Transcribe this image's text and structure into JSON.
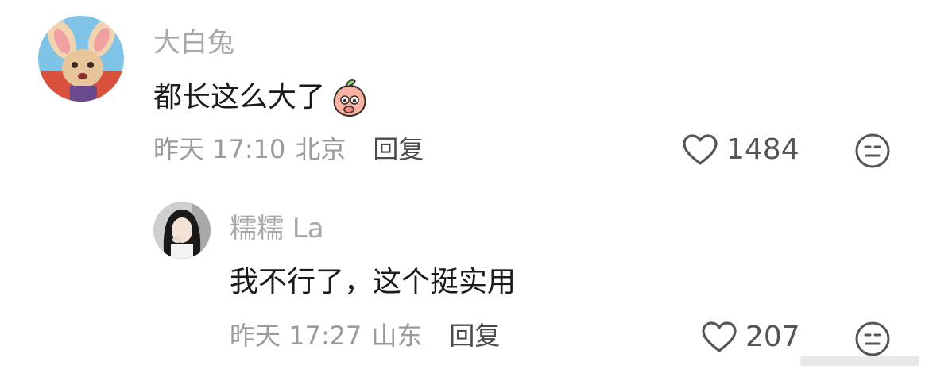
{
  "comments": [
    {
      "username": "大白兔",
      "text": "都长这么大了",
      "emoji_icon": "peach-face-emoji",
      "time": "昨天 17:10",
      "location": "北京",
      "reply_label": "回复",
      "like_count": "1484",
      "dislike_icon": "neutral-face-icon"
    },
    {
      "username": "糯糯 La",
      "text": "我不行了，这个挺实用",
      "time": "昨天 17:27",
      "location": "山东",
      "reply_label": "回复",
      "like_count": "207",
      "dislike_icon": "neutral-face-icon"
    }
  ],
  "colors": {
    "username": "#a8a8a8",
    "text": "#1a1a1a",
    "meta": "#9a9a9a",
    "reply": "#4a4a4a",
    "icon_stroke": "#555555"
  }
}
